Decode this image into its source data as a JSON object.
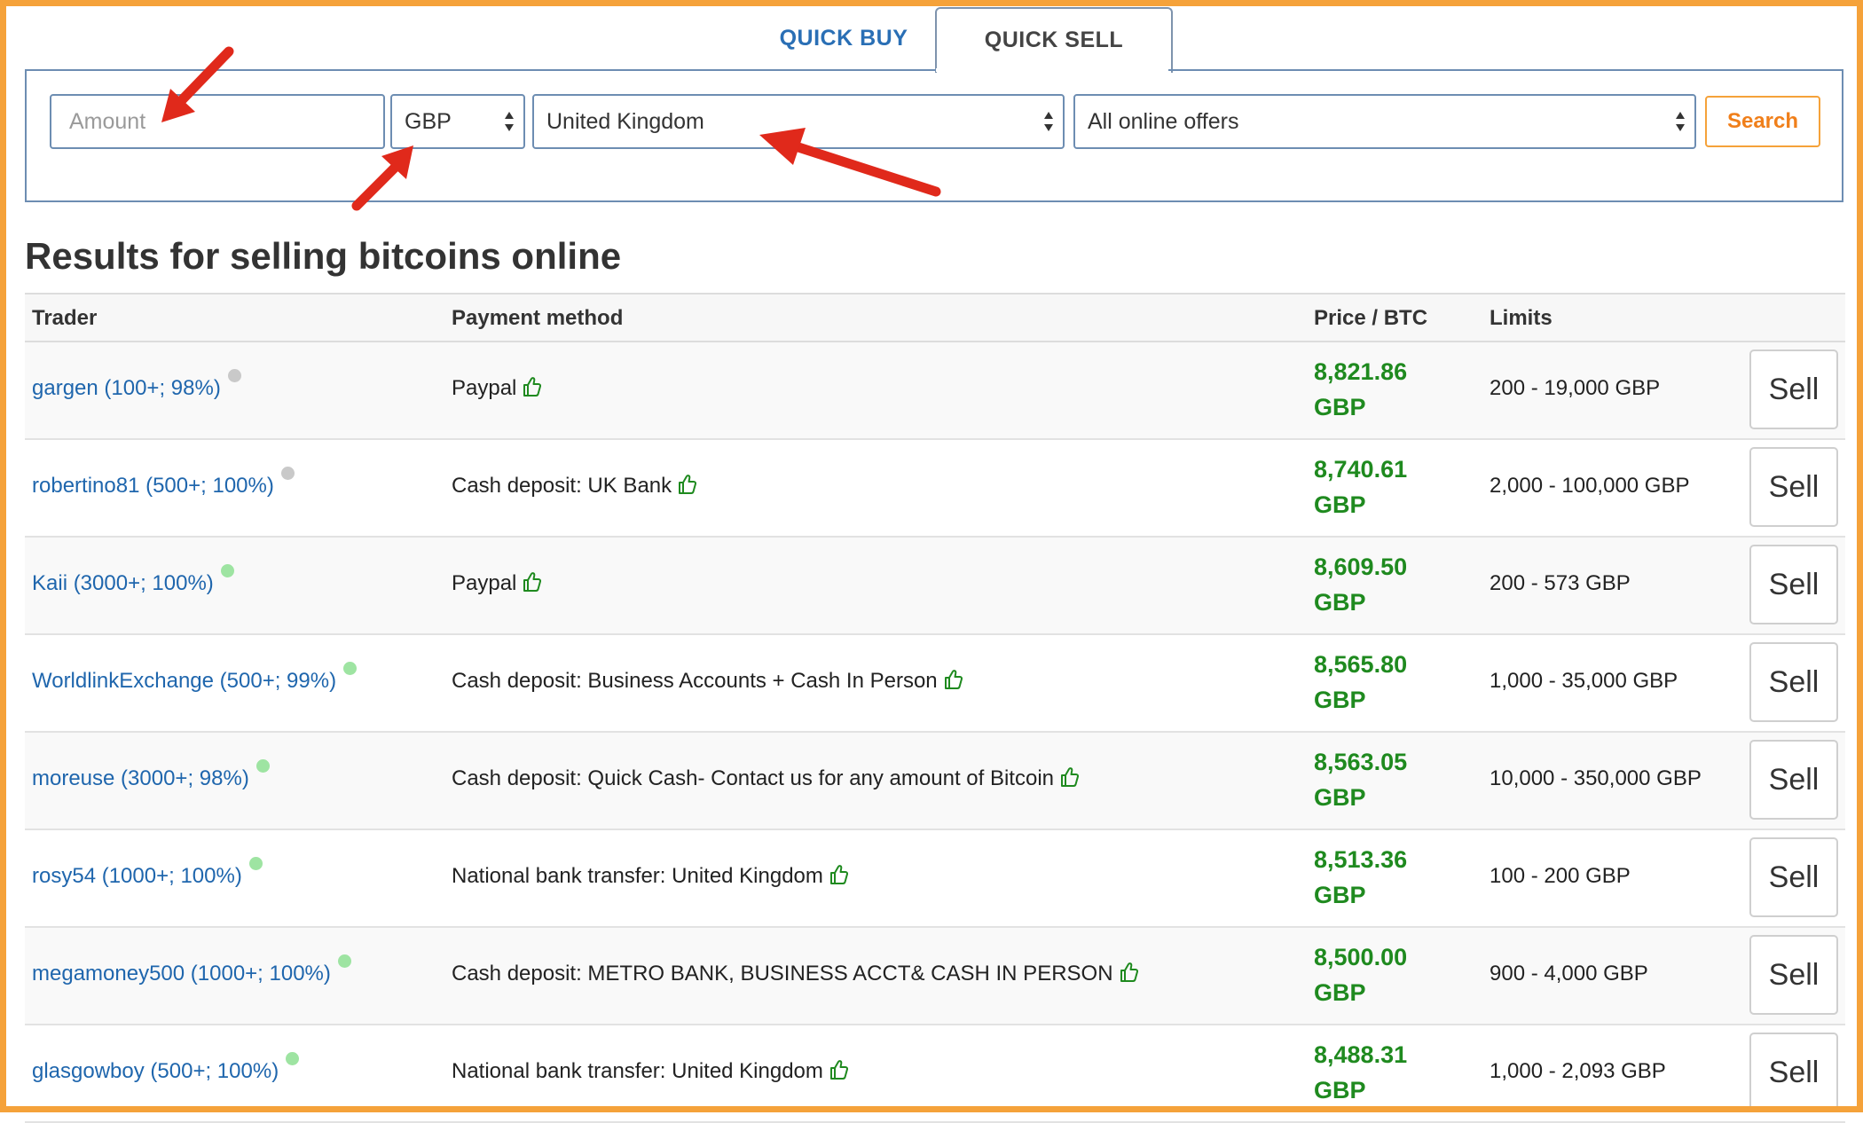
{
  "tabs": {
    "quick_buy": "QUICK BUY",
    "quick_sell": "QUICK SELL"
  },
  "search_form": {
    "amount_placeholder": "Amount",
    "currency": "GBP",
    "country": "United Kingdom",
    "offer_filter": "All online offers",
    "search_label": "Search"
  },
  "results_title": "Results for selling bitcoins online",
  "table": {
    "headers": {
      "trader": "Trader",
      "payment": "Payment method",
      "price": "Price / BTC",
      "limits": "Limits"
    },
    "sell_label": "Sell",
    "rows": [
      {
        "trader": "gargen (100+; 98%)",
        "status": "grey",
        "payment": "Paypal",
        "price": "8,821.86",
        "currency": "GBP",
        "limits": "200 - 19,000 GBP"
      },
      {
        "trader": "robertino81 (500+; 100%)",
        "status": "grey",
        "payment": "Cash deposit: UK Bank",
        "price": "8,740.61",
        "currency": "GBP",
        "limits": "2,000 - 100,000 GBP"
      },
      {
        "trader": "Kaii (3000+; 100%)",
        "status": "green",
        "payment": "Paypal",
        "price": "8,609.50",
        "currency": "GBP",
        "limits": "200 - 573 GBP"
      },
      {
        "trader": "WorldlinkExchange (500+; 99%)",
        "status": "green",
        "payment": "Cash deposit: Business Accounts + Cash In Person",
        "price": "8,565.80",
        "currency": "GBP",
        "limits": "1,000 - 35,000 GBP"
      },
      {
        "trader": "moreuse (3000+; 98%)",
        "status": "green",
        "payment": "Cash deposit: Quick Cash- Contact us for any amount of Bitcoin",
        "price": "8,563.05",
        "currency": "GBP",
        "limits": "10,000 - 350,000 GBP"
      },
      {
        "trader": "rosy54 (1000+; 100%)",
        "status": "green",
        "payment": "National bank transfer: United Kingdom",
        "price": "8,513.36",
        "currency": "GBP",
        "limits": "100 - 200 GBP"
      },
      {
        "trader": "megamoney500 (1000+; 100%)",
        "status": "green",
        "payment": "Cash deposit: METRO BANK, BUSINESS ACCT& CASH IN PERSON",
        "price": "8,500.00",
        "currency": "GBP",
        "limits": "900 - 4,000 GBP"
      },
      {
        "trader": "glasgowboy (500+; 100%)",
        "status": "green",
        "payment": "National bank transfer: United Kingdom",
        "price": "8,488.31",
        "currency": "GBP",
        "limits": "1,000 - 2,093 GBP"
      }
    ]
  },
  "colors": {
    "accent_orange": "#f5a23a",
    "link_blue": "#1f66ad",
    "price_green": "#1f8a1f",
    "annotation_red": "#e0291b"
  },
  "icons": {
    "thumbs_up": "thumbs-up-icon",
    "status_dot": "status-dot-icon",
    "select_arrows": "select-arrows-icon",
    "annotation_arrow": "red-arrow-annotation"
  }
}
